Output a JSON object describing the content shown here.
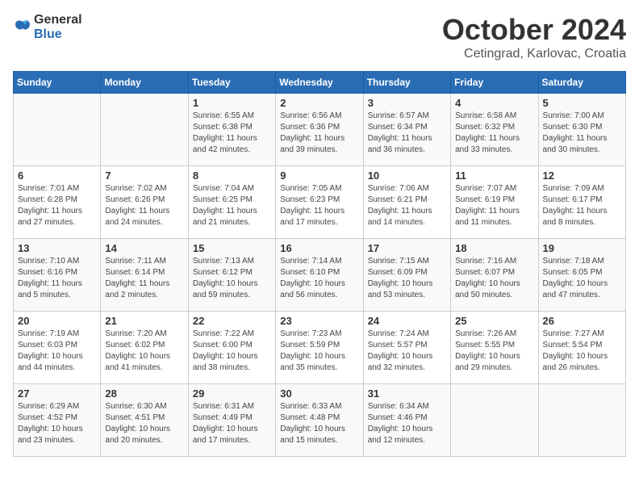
{
  "header": {
    "logo_general": "General",
    "logo_blue": "Blue",
    "title": "October 2024",
    "subtitle": "Cetingrad, Karlovac, Croatia"
  },
  "days_of_week": [
    "Sunday",
    "Monday",
    "Tuesday",
    "Wednesday",
    "Thursday",
    "Friday",
    "Saturday"
  ],
  "weeks": [
    [
      {
        "day": "",
        "info": ""
      },
      {
        "day": "",
        "info": ""
      },
      {
        "day": "1",
        "info": "Sunrise: 6:55 AM\nSunset: 6:38 PM\nDaylight: 11 hours and 42 minutes."
      },
      {
        "day": "2",
        "info": "Sunrise: 6:56 AM\nSunset: 6:36 PM\nDaylight: 11 hours and 39 minutes."
      },
      {
        "day": "3",
        "info": "Sunrise: 6:57 AM\nSunset: 6:34 PM\nDaylight: 11 hours and 36 minutes."
      },
      {
        "day": "4",
        "info": "Sunrise: 6:58 AM\nSunset: 6:32 PM\nDaylight: 11 hours and 33 minutes."
      },
      {
        "day": "5",
        "info": "Sunrise: 7:00 AM\nSunset: 6:30 PM\nDaylight: 11 hours and 30 minutes."
      }
    ],
    [
      {
        "day": "6",
        "info": "Sunrise: 7:01 AM\nSunset: 6:28 PM\nDaylight: 11 hours and 27 minutes."
      },
      {
        "day": "7",
        "info": "Sunrise: 7:02 AM\nSunset: 6:26 PM\nDaylight: 11 hours and 24 minutes."
      },
      {
        "day": "8",
        "info": "Sunrise: 7:04 AM\nSunset: 6:25 PM\nDaylight: 11 hours and 21 minutes."
      },
      {
        "day": "9",
        "info": "Sunrise: 7:05 AM\nSunset: 6:23 PM\nDaylight: 11 hours and 17 minutes."
      },
      {
        "day": "10",
        "info": "Sunrise: 7:06 AM\nSunset: 6:21 PM\nDaylight: 11 hours and 14 minutes."
      },
      {
        "day": "11",
        "info": "Sunrise: 7:07 AM\nSunset: 6:19 PM\nDaylight: 11 hours and 11 minutes."
      },
      {
        "day": "12",
        "info": "Sunrise: 7:09 AM\nSunset: 6:17 PM\nDaylight: 11 hours and 8 minutes."
      }
    ],
    [
      {
        "day": "13",
        "info": "Sunrise: 7:10 AM\nSunset: 6:16 PM\nDaylight: 11 hours and 5 minutes."
      },
      {
        "day": "14",
        "info": "Sunrise: 7:11 AM\nSunset: 6:14 PM\nDaylight: 11 hours and 2 minutes."
      },
      {
        "day": "15",
        "info": "Sunrise: 7:13 AM\nSunset: 6:12 PM\nDaylight: 10 hours and 59 minutes."
      },
      {
        "day": "16",
        "info": "Sunrise: 7:14 AM\nSunset: 6:10 PM\nDaylight: 10 hours and 56 minutes."
      },
      {
        "day": "17",
        "info": "Sunrise: 7:15 AM\nSunset: 6:09 PM\nDaylight: 10 hours and 53 minutes."
      },
      {
        "day": "18",
        "info": "Sunrise: 7:16 AM\nSunset: 6:07 PM\nDaylight: 10 hours and 50 minutes."
      },
      {
        "day": "19",
        "info": "Sunrise: 7:18 AM\nSunset: 6:05 PM\nDaylight: 10 hours and 47 minutes."
      }
    ],
    [
      {
        "day": "20",
        "info": "Sunrise: 7:19 AM\nSunset: 6:03 PM\nDaylight: 10 hours and 44 minutes."
      },
      {
        "day": "21",
        "info": "Sunrise: 7:20 AM\nSunset: 6:02 PM\nDaylight: 10 hours and 41 minutes."
      },
      {
        "day": "22",
        "info": "Sunrise: 7:22 AM\nSunset: 6:00 PM\nDaylight: 10 hours and 38 minutes."
      },
      {
        "day": "23",
        "info": "Sunrise: 7:23 AM\nSunset: 5:59 PM\nDaylight: 10 hours and 35 minutes."
      },
      {
        "day": "24",
        "info": "Sunrise: 7:24 AM\nSunset: 5:57 PM\nDaylight: 10 hours and 32 minutes."
      },
      {
        "day": "25",
        "info": "Sunrise: 7:26 AM\nSunset: 5:55 PM\nDaylight: 10 hours and 29 minutes."
      },
      {
        "day": "26",
        "info": "Sunrise: 7:27 AM\nSunset: 5:54 PM\nDaylight: 10 hours and 26 minutes."
      }
    ],
    [
      {
        "day": "27",
        "info": "Sunrise: 6:29 AM\nSunset: 4:52 PM\nDaylight: 10 hours and 23 minutes."
      },
      {
        "day": "28",
        "info": "Sunrise: 6:30 AM\nSunset: 4:51 PM\nDaylight: 10 hours and 20 minutes."
      },
      {
        "day": "29",
        "info": "Sunrise: 6:31 AM\nSunset: 4:49 PM\nDaylight: 10 hours and 17 minutes."
      },
      {
        "day": "30",
        "info": "Sunrise: 6:33 AM\nSunset: 4:48 PM\nDaylight: 10 hours and 15 minutes."
      },
      {
        "day": "31",
        "info": "Sunrise: 6:34 AM\nSunset: 4:46 PM\nDaylight: 10 hours and 12 minutes."
      },
      {
        "day": "",
        "info": ""
      },
      {
        "day": "",
        "info": ""
      }
    ]
  ]
}
